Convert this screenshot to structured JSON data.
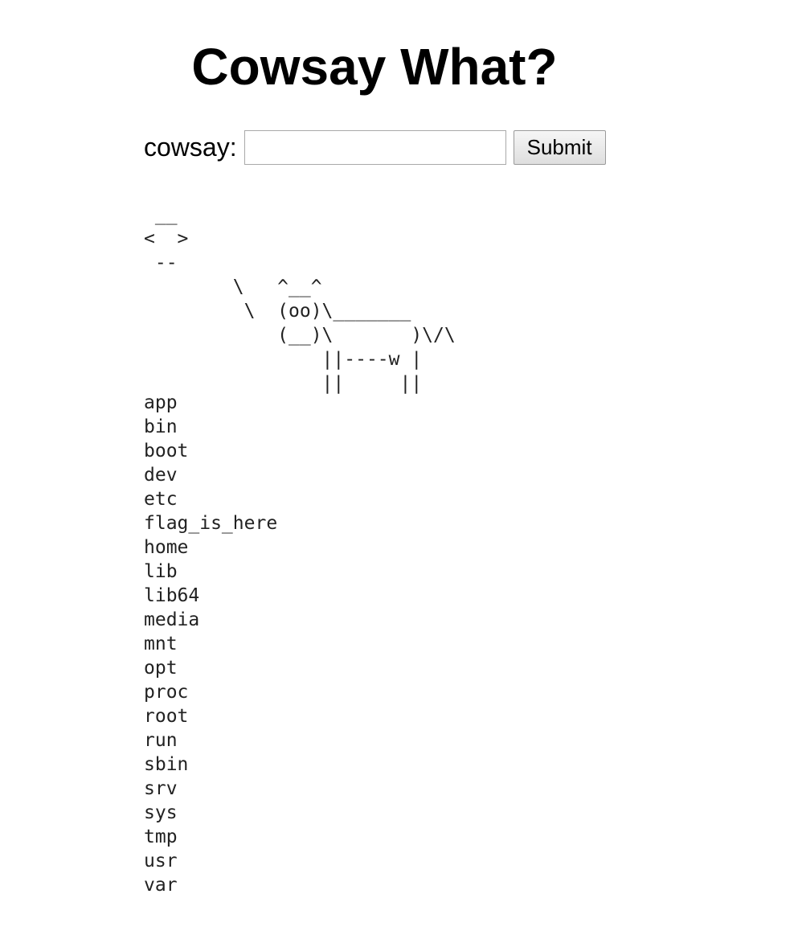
{
  "page": {
    "title": "Cowsay What?"
  },
  "form": {
    "label": "cowsay:",
    "input_value": "",
    "input_placeholder": "",
    "submit_label": "Submit"
  },
  "output": {
    "cow_lines": [
      " __",
      "<  >",
      " --",
      "        \\   ^__^",
      "         \\  (oo)\\_______",
      "            (__)\\       )\\/\\",
      "                ||----w |",
      "                ||     ||"
    ],
    "listing": [
      "app",
      "bin",
      "boot",
      "dev",
      "etc",
      "flag_is_here",
      "home",
      "lib",
      "lib64",
      "media",
      "mnt",
      "opt",
      "proc",
      "root",
      "run",
      "sbin",
      "srv",
      "sys",
      "tmp",
      "usr",
      "var"
    ]
  }
}
